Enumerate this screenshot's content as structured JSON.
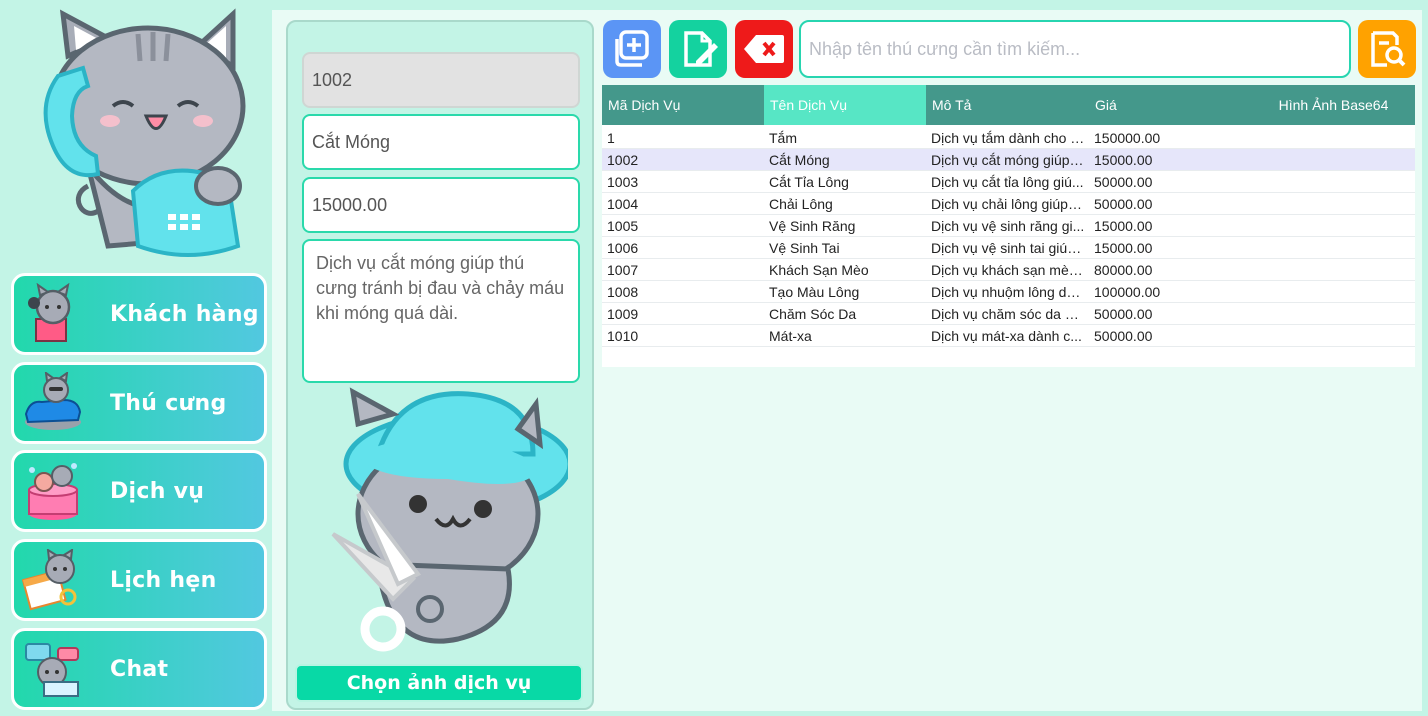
{
  "sidebar": {
    "items": [
      {
        "label": "Khách hàng",
        "icon": "customer-cat-icon"
      },
      {
        "label": "Thú cưng",
        "icon": "pet-car-cat-icon"
      },
      {
        "label": "Dịch vụ",
        "icon": "service-bath-cat-icon"
      },
      {
        "label": "Lịch hẹn",
        "icon": "calendar-cat-icon"
      },
      {
        "label": "Chat",
        "icon": "chat-cat-icon"
      }
    ]
  },
  "form": {
    "id": "1002",
    "name": "Cắt Móng",
    "price": "15000.00",
    "description": "Dịch vụ cắt móng giúp thú cưng tránh bị đau và chảy máu khi móng quá dài.",
    "choose_image_label": "Chọn ảnh dịch vụ"
  },
  "toolbar": {
    "add_icon": "add-icon",
    "edit_icon": "edit-icon",
    "delete_icon": "delete-icon",
    "search_placeholder": "Nhập tên thú cưng cần tìm kiếm...",
    "search_icon": "search-icon"
  },
  "colors": {
    "add": "#5b95f5",
    "edit": "#14d29f",
    "delete": "#ee1a1a",
    "search": "#ffa200",
    "header": "#44988b",
    "header_active": "#57e6c5"
  },
  "table": {
    "columns": [
      "Mã Dịch Vụ",
      "Tên Dịch Vụ",
      "Mô Tả",
      "Giá",
      "Hình Ảnh Base64"
    ],
    "rows": [
      [
        "1",
        "Tắm",
        "Dịch vụ tắm dành cho c...",
        "150000.00",
        ""
      ],
      [
        "1002",
        "Cắt Móng",
        "Dịch vụ cắt móng giúp ...",
        "15000.00",
        ""
      ],
      [
        "1003",
        "Cắt Tỉa Lông",
        "Dịch vụ cắt tỉa lông giú...",
        "50000.00",
        ""
      ],
      [
        "1004",
        "Chải Lông",
        "Dịch vụ chải lông giúp l...",
        "50000.00",
        ""
      ],
      [
        "1005",
        "Vệ Sinh Răng",
        "Dịch vụ vệ sinh răng gi...",
        "15000.00",
        ""
      ],
      [
        "1006",
        "Vệ Sinh Tai",
        "Dịch vụ vệ sinh tai giúp...",
        "15000.00",
        ""
      ],
      [
        "1007",
        "Khách Sạn Mèo",
        "Dịch vụ khách sạn mèo...",
        "80000.00",
        ""
      ],
      [
        "1008",
        "Tạo Màu Lông",
        "Dịch vụ nhuộm lông dà...",
        "100000.00",
        ""
      ],
      [
        "1009",
        "Chăm Sóc Da",
        "Dịch vụ chăm sóc da dà...",
        "50000.00",
        ""
      ],
      [
        "1010",
        "Mát-xa",
        "Dịch vụ mát-xa dành c...",
        "50000.00",
        ""
      ]
    ],
    "selected_row": 1,
    "sorted_column": 1
  }
}
